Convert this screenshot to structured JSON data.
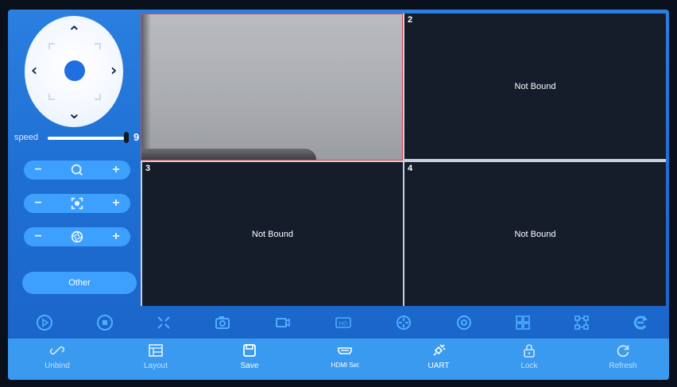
{
  "ptz": {
    "speed_label": "speed",
    "speed_value": "9"
  },
  "left_panel": {
    "zoom_minus": "−",
    "zoom_plus": "+",
    "focus_minus": "−",
    "focus_plus": "+",
    "iris_minus": "−",
    "iris_plus": "+",
    "other_label": "Other"
  },
  "grid": {
    "cells": [
      {
        "num": "",
        "status": ""
      },
      {
        "num": "2",
        "status": "Not Bound"
      },
      {
        "num": "3",
        "status": "Not Bound"
      },
      {
        "num": "4",
        "status": "Not Bound"
      }
    ]
  },
  "control_icons": [
    "play-icon",
    "stop-icon",
    "fullscreen-icon",
    "snapshot-icon",
    "record-icon",
    "hd-icon",
    "crosshair-icon",
    "target-icon",
    "quad-grid-icon",
    "frame-icon",
    "refresh-e-icon"
  ],
  "toolbar": {
    "items": [
      {
        "label": "Unbind",
        "icon": "unlink-icon"
      },
      {
        "label": "Layout",
        "icon": "layout-icon"
      },
      {
        "label": "Save",
        "icon": "save-icon"
      },
      {
        "label": "HDMI Set",
        "icon": "hdmi-icon"
      },
      {
        "label": "UART",
        "icon": "uart-icon"
      },
      {
        "label": "Lock",
        "icon": "lock-icon"
      },
      {
        "label": "Refresh",
        "icon": "refresh-icon"
      }
    ]
  },
  "colors": {
    "accent": "#3da0ff",
    "icon_blue": "#4db0ff",
    "selected_border": "#d64a4a"
  }
}
